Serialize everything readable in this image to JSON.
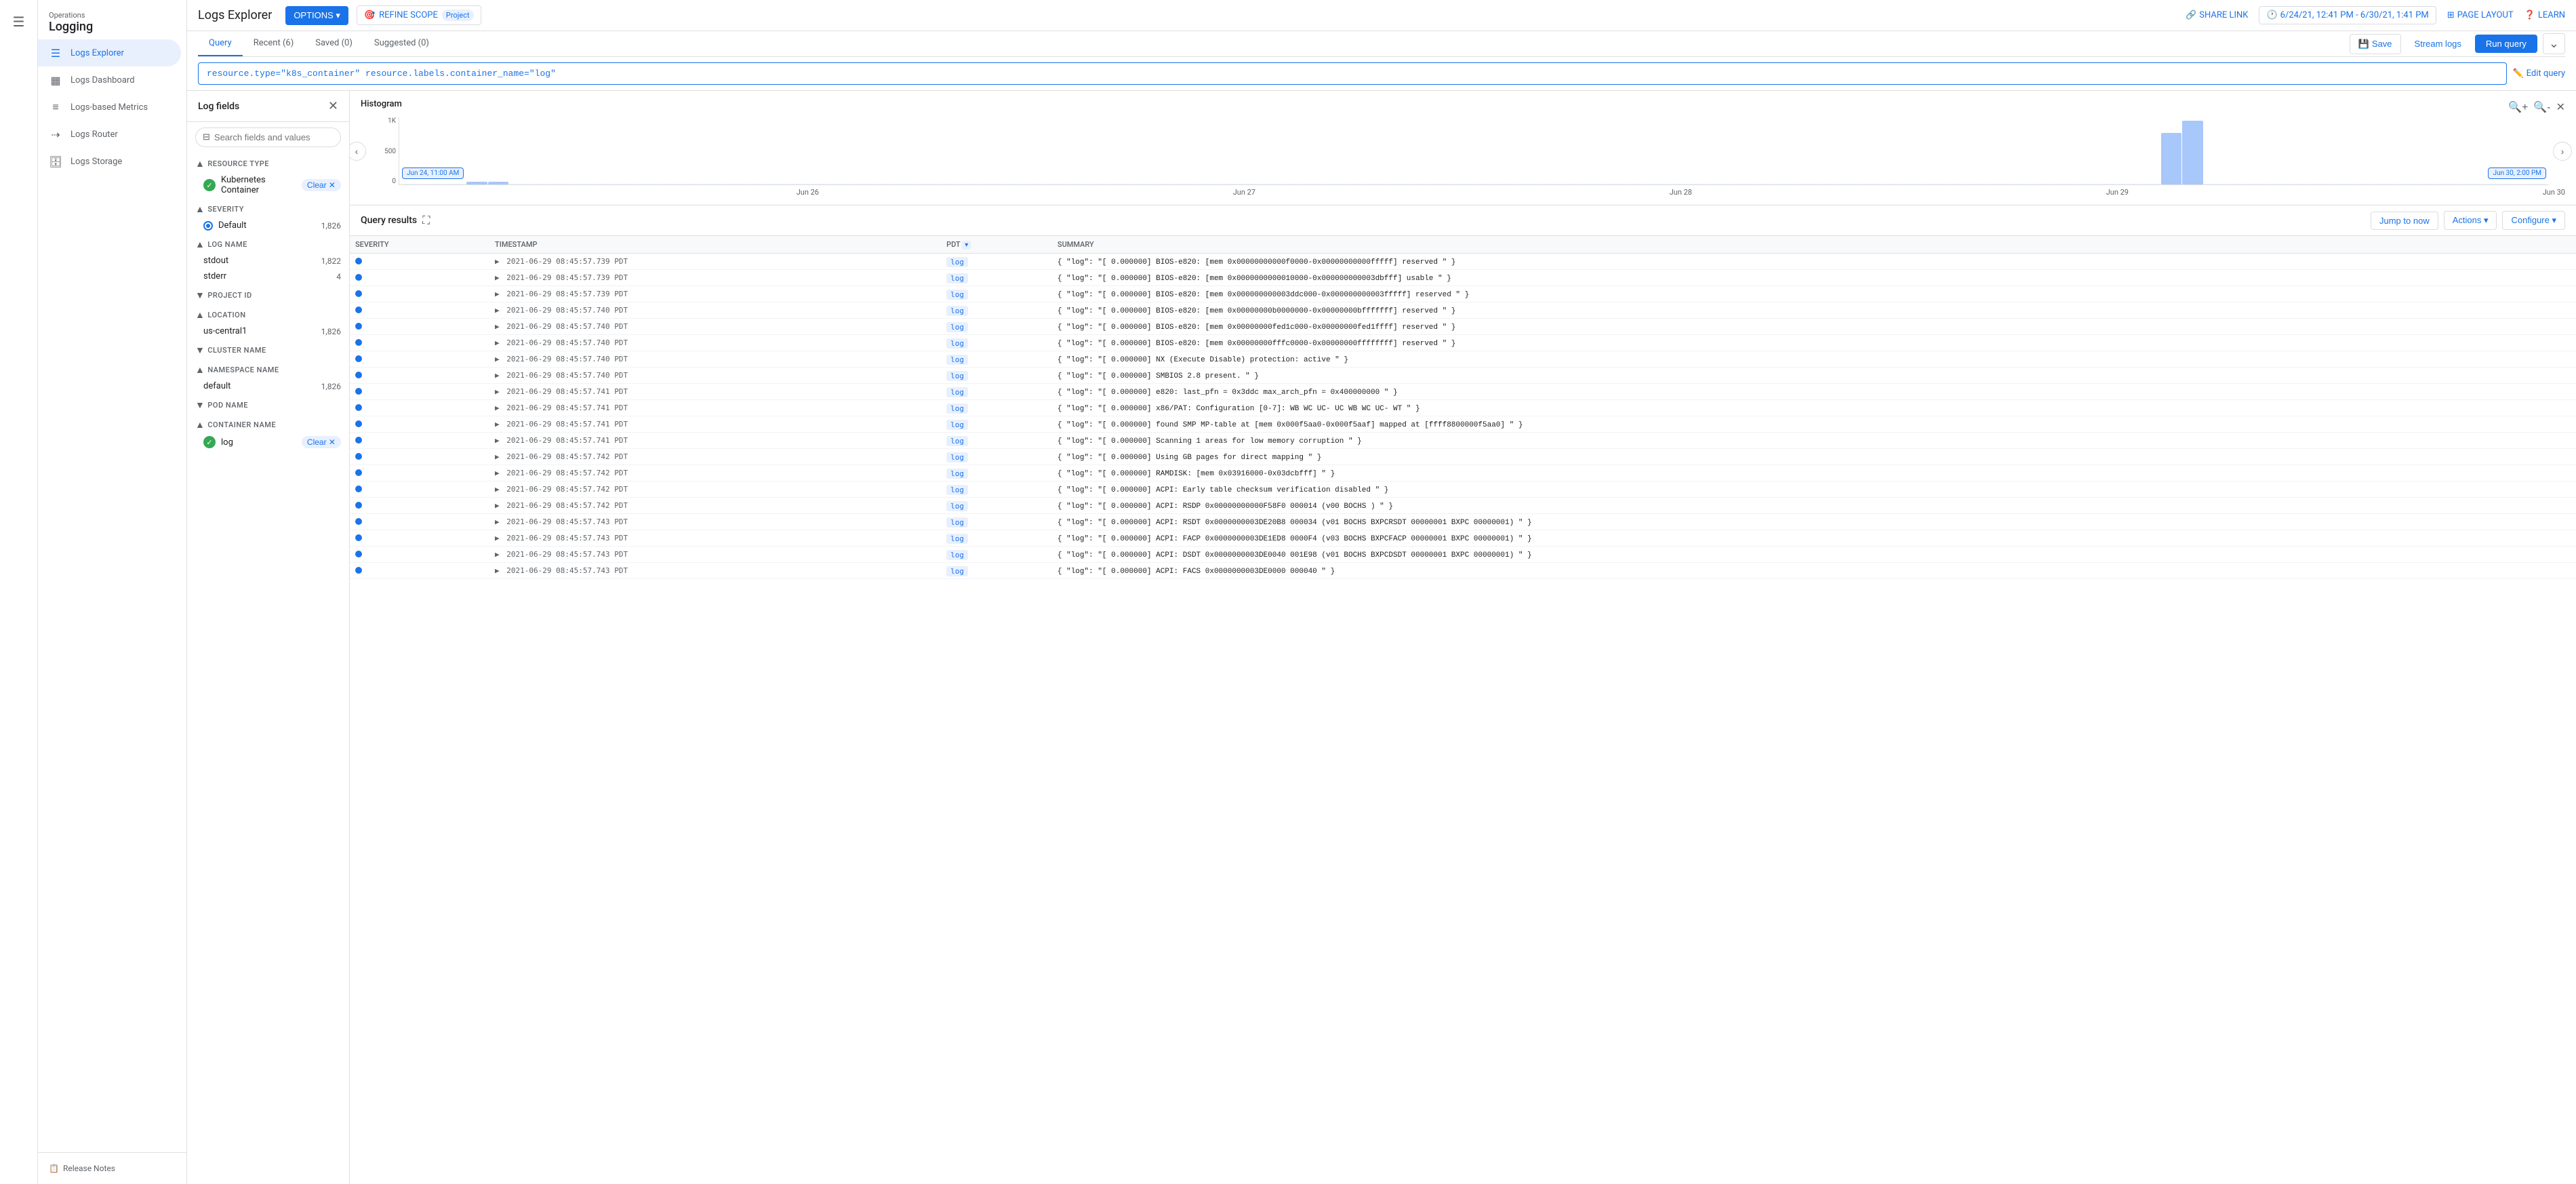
{
  "app": {
    "product": "Operations",
    "title": "Logging"
  },
  "topbar": {
    "page_title": "Logs Explorer",
    "options_label": "OPTIONS ▾",
    "refine_scope_label": "REFINE SCOPE",
    "refine_scope_badge": "Project",
    "share_link_label": "SHARE LINK",
    "date_range": "6/24/21, 12:41 PM - 6/30/21, 1:41 PM",
    "page_layout_label": "PAGE LAYOUT",
    "learn_label": "LEARN"
  },
  "query_bar": {
    "tabs": [
      {
        "label": "Query",
        "active": true
      },
      {
        "label": "Recent (6)",
        "active": false
      },
      {
        "label": "Saved (0)",
        "active": false
      },
      {
        "label": "Suggested (0)",
        "active": false
      }
    ],
    "save_label": "Save",
    "stream_logs_label": "Stream logs",
    "run_query_label": "Run query",
    "query_text": "resource.type=\"k8s_container\" resource.labels.container_name=\"log\"",
    "edit_query_label": "Edit query"
  },
  "sidebar": {
    "items": [
      {
        "label": "Logs Explorer",
        "active": true,
        "icon": "☰"
      },
      {
        "label": "Logs Dashboard",
        "active": false,
        "icon": "▦"
      },
      {
        "label": "Logs-based Metrics",
        "active": false,
        "icon": "≡"
      },
      {
        "label": "Logs Router",
        "active": false,
        "icon": "⇢"
      },
      {
        "label": "Logs Storage",
        "active": false,
        "icon": "🗄"
      }
    ],
    "footer": {
      "release_notes": "Release Notes"
    }
  },
  "log_fields": {
    "title": "Log fields",
    "search_placeholder": "Search fields and values",
    "sections": [
      {
        "name": "RESOURCE TYPE",
        "expanded": true,
        "items": [
          {
            "label": "Kubernetes Container",
            "checked": true,
            "count": null,
            "clearable": true
          }
        ]
      },
      {
        "name": "SEVERITY",
        "expanded": true,
        "items": [
          {
            "label": "Default",
            "checked": false,
            "dot": true,
            "count": "1,826",
            "clearable": false
          }
        ]
      },
      {
        "name": "LOG NAME",
        "expanded": true,
        "items": [
          {
            "label": "stdout",
            "checked": false,
            "count": "1,822",
            "clearable": false
          },
          {
            "label": "stderr",
            "checked": false,
            "count": "4",
            "clearable": false
          }
        ]
      },
      {
        "name": "PROJECT ID",
        "expanded": false,
        "items": []
      },
      {
        "name": "LOCATION",
        "expanded": true,
        "items": [
          {
            "label": "us-central1",
            "checked": false,
            "count": "1,826",
            "clearable": false
          }
        ]
      },
      {
        "name": "CLUSTER NAME",
        "expanded": false,
        "items": []
      },
      {
        "name": "NAMESPACE NAME",
        "expanded": true,
        "items": [
          {
            "label": "default",
            "checked": false,
            "count": "1,826",
            "clearable": false
          }
        ]
      },
      {
        "name": "POD NAME",
        "expanded": false,
        "items": []
      },
      {
        "name": "CONTAINER NAME",
        "expanded": true,
        "items": [
          {
            "label": "log",
            "checked": true,
            "count": null,
            "clearable": true
          }
        ]
      }
    ]
  },
  "histogram": {
    "title": "Histogram",
    "y_labels": [
      "1K",
      "500",
      "0"
    ],
    "dates": [
      "Jun 24, 11:00 AM",
      "Jun 26",
      "Jun 27",
      "Jun 28",
      "Jun 29",
      "Jun 30, 2:00 PM"
    ],
    "bars": [
      0,
      0,
      0,
      2,
      1,
      0,
      0,
      0,
      0,
      0,
      0,
      0,
      0,
      0,
      0,
      0,
      0,
      0,
      0,
      0,
      0,
      0,
      0,
      0,
      0,
      0,
      0,
      0,
      0,
      0,
      0,
      0,
      0,
      0,
      0,
      0,
      0,
      0,
      0,
      0,
      0,
      0,
      0,
      0,
      0,
      0,
      0,
      0,
      0,
      0,
      0,
      0,
      0,
      0,
      0,
      0,
      0,
      0,
      0,
      0,
      0,
      0,
      0,
      0,
      0,
      0,
      0,
      0,
      0,
      0,
      0,
      0,
      0,
      0,
      0,
      0,
      0,
      0,
      0,
      0,
      0,
      0,
      65,
      80,
      0,
      0,
      0,
      0,
      0,
      0,
      0,
      0,
      0,
      0,
      0,
      0,
      0,
      0,
      0,
      0
    ]
  },
  "results": {
    "title": "Query results",
    "jump_to_now": "Jump to now",
    "actions_label": "Actions ▾",
    "configure_label": "Configure ▾",
    "columns": [
      "SEVERITY",
      "TIMESTAMP",
      "PDT ▾",
      "SUMMARY"
    ],
    "rows": [
      {
        "severity": "●",
        "timestamp": "2021-06-29 08:45:57.739 PDT",
        "badge": "log",
        "summary": "{ \"log\": \"[ 0.000000] BIOS-e820: [mem 0x00000000000f0000-0x00000000000fffff] reserved \" }"
      },
      {
        "severity": "●",
        "timestamp": "2021-06-29 08:45:57.739 PDT",
        "badge": "log",
        "summary": "{ \"log\": \"[ 0.000000] BIOS-e820: [mem 0x0000000000010000-0x000000000003dbfff] usable \" }"
      },
      {
        "severity": "●",
        "timestamp": "2021-06-29 08:45:57.739 PDT",
        "badge": "log",
        "summary": "{ \"log\": \"[ 0.000000] BIOS-e820: [mem 0x000000000003ddc000-0x000000000003fffff] reserved \" }"
      },
      {
        "severity": "●",
        "timestamp": "2021-06-29 08:45:57.740 PDT",
        "badge": "log",
        "summary": "{ \"log\": \"[ 0.000000] BIOS-e820: [mem 0x00000000b0000000-0x00000000bfffffff] reserved \" }"
      },
      {
        "severity": "●",
        "timestamp": "2021-06-29 08:45:57.740 PDT",
        "badge": "log",
        "summary": "{ \"log\": \"[ 0.000000] BIOS-e820: [mem 0x00000000fed1c000-0x00000000fed1ffff] reserved \" }"
      },
      {
        "severity": "●",
        "timestamp": "2021-06-29 08:45:57.740 PDT",
        "badge": "log",
        "summary": "{ \"log\": \"[ 0.000000] BIOS-e820: [mem 0x00000000fffc0000-0x00000000ffffffff] reserved \" }"
      },
      {
        "severity": "●",
        "timestamp": "2021-06-29 08:45:57.740 PDT",
        "badge": "log",
        "summary": "{ \"log\": \"[ 0.000000] NX (Execute Disable) protection: active \" }"
      },
      {
        "severity": "●",
        "timestamp": "2021-06-29 08:45:57.740 PDT",
        "badge": "log",
        "summary": "{ \"log\": \"[ 0.000000] SMBIOS 2.8 present. \" }"
      },
      {
        "severity": "●",
        "timestamp": "2021-06-29 08:45:57.741 PDT",
        "badge": "log",
        "summary": "{ \"log\": \"[ 0.000000] e820: last_pfn = 0x3ddc max_arch_pfn = 0x400000000 \" }"
      },
      {
        "severity": "●",
        "timestamp": "2021-06-29 08:45:57.741 PDT",
        "badge": "log",
        "summary": "{ \"log\": \"[ 0.000000] x86/PAT: Configuration [0-7]: WB WC UC- UC WB WC UC- WT \" }"
      },
      {
        "severity": "●",
        "timestamp": "2021-06-29 08:45:57.741 PDT",
        "badge": "log",
        "summary": "{ \"log\": \"[ 0.000000] found SMP MP-table at [mem 0x000f5aa0-0x000f5aaf] mapped at [ffff8800000f5aa0] \" }"
      },
      {
        "severity": "●",
        "timestamp": "2021-06-29 08:45:57.741 PDT",
        "badge": "log",
        "summary": "{ \"log\": \"[ 0.000000] Scanning 1 areas for low memory corruption \" }"
      },
      {
        "severity": "●",
        "timestamp": "2021-06-29 08:45:57.742 PDT",
        "badge": "log",
        "summary": "{ \"log\": \"[ 0.000000] Using GB pages for direct mapping \" }"
      },
      {
        "severity": "●",
        "timestamp": "2021-06-29 08:45:57.742 PDT",
        "badge": "log",
        "summary": "{ \"log\": \"[ 0.000000] RAMDISK: [mem 0x03916000-0x03dcbfff] \" }"
      },
      {
        "severity": "●",
        "timestamp": "2021-06-29 08:45:57.742 PDT",
        "badge": "log",
        "summary": "{ \"log\": \"[ 0.000000] ACPI: Early table checksum verification disabled \" }"
      },
      {
        "severity": "●",
        "timestamp": "2021-06-29 08:45:57.742 PDT",
        "badge": "log",
        "summary": "{ \"log\": \"[ 0.000000] ACPI: RSDP 0x00000000000F58F0 000014 (v00 BOCHS ) \" }"
      },
      {
        "severity": "●",
        "timestamp": "2021-06-29 08:45:57.743 PDT",
        "badge": "log",
        "summary": "{ \"log\": \"[ 0.000000] ACPI: RSDT 0x0000000003DE20B8 000034 (v01 BOCHS BXPCRSDT 00000001 BXPC 00000001) \" }"
      },
      {
        "severity": "●",
        "timestamp": "2021-06-29 08:45:57.743 PDT",
        "badge": "log",
        "summary": "{ \"log\": \"[ 0.000000] ACPI: FACP 0x0000000003DE1ED8 0000F4 (v03 BOCHS BXPCFACP 00000001 BXPC 00000001) \" }"
      },
      {
        "severity": "●",
        "timestamp": "2021-06-29 08:45:57.743 PDT",
        "badge": "log",
        "summary": "{ \"log\": \"[ 0.000000] ACPI: DSDT 0x0000000003DE0040 001E98 (v01 BOCHS BXPCDSDT 00000001 BXPC 00000001) \" }"
      },
      {
        "severity": "●",
        "timestamp": "2021-06-29 08:45:57.743 PDT",
        "badge": "log",
        "summary": "{ \"log\": \"[ 0.000000] ACPI: FACS 0x0000000003DE0000 000040 \" }"
      }
    ]
  }
}
